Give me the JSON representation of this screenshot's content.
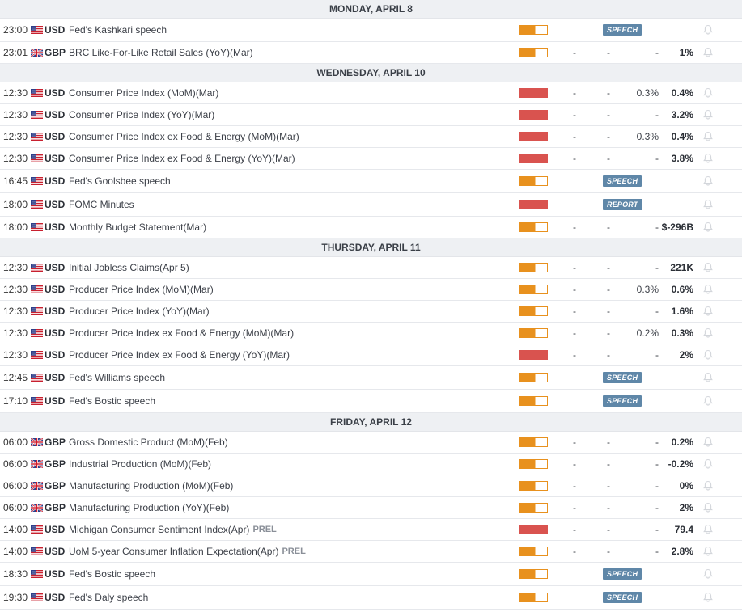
{
  "legend_colors": {
    "high_impact": "#d9534f",
    "medium_impact": "#e8911e",
    "badge": "#5f87a8"
  },
  "calendar": [
    {
      "day": "MONDAY, APRIL 8",
      "events": [
        {
          "time": "23:00",
          "flag_icon": "us-flag-icon",
          "currency": "USD",
          "name": "Fed's Kashkari speech",
          "impact": "medium",
          "badge": "SPEECH"
        },
        {
          "time": "23:01",
          "flag_icon": "uk-flag-icon",
          "currency": "GBP",
          "name": "BRC Like-For-Like Retail Sales (YoY)(Mar)",
          "impact": "medium",
          "actual": "-",
          "deviation": "-",
          "consensus": "-",
          "previous": "1%"
        }
      ]
    },
    {
      "day": "WEDNESDAY, APRIL 10",
      "events": [
        {
          "time": "12:30",
          "flag_icon": "us-flag-icon",
          "currency": "USD",
          "name": "Consumer Price Index (MoM)(Mar)",
          "impact": "high",
          "actual": "-",
          "deviation": "-",
          "consensus": "0.3%",
          "previous": "0.4%"
        },
        {
          "time": "12:30",
          "flag_icon": "us-flag-icon",
          "currency": "USD",
          "name": "Consumer Price Index (YoY)(Mar)",
          "impact": "high",
          "actual": "-",
          "deviation": "-",
          "consensus": "-",
          "previous": "3.2%"
        },
        {
          "time": "12:30",
          "flag_icon": "us-flag-icon",
          "currency": "USD",
          "name": "Consumer Price Index ex Food & Energy (MoM)(Mar)",
          "impact": "high",
          "actual": "-",
          "deviation": "-",
          "consensus": "0.3%",
          "previous": "0.4%"
        },
        {
          "time": "12:30",
          "flag_icon": "us-flag-icon",
          "currency": "USD",
          "name": "Consumer Price Index ex Food & Energy (YoY)(Mar)",
          "impact": "high",
          "actual": "-",
          "deviation": "-",
          "consensus": "-",
          "previous": "3.8%"
        },
        {
          "time": "16:45",
          "flag_icon": "us-flag-icon",
          "currency": "USD",
          "name": "Fed's Goolsbee speech",
          "impact": "medium",
          "badge": "SPEECH"
        },
        {
          "time": "18:00",
          "flag_icon": "us-flag-icon",
          "currency": "USD",
          "name": "FOMC Minutes",
          "impact": "high",
          "badge": "REPORT"
        },
        {
          "time": "18:00",
          "flag_icon": "us-flag-icon",
          "currency": "USD",
          "name": "Monthly Budget Statement(Mar)",
          "impact": "medium",
          "actual": "-",
          "deviation": "-",
          "consensus": "-",
          "previous": "$-296B"
        }
      ]
    },
    {
      "day": "THURSDAY, APRIL 11",
      "events": [
        {
          "time": "12:30",
          "flag_icon": "us-flag-icon",
          "currency": "USD",
          "name": "Initial Jobless Claims(Apr 5)",
          "impact": "medium",
          "actual": "-",
          "deviation": "-",
          "consensus": "-",
          "previous": "221K"
        },
        {
          "time": "12:30",
          "flag_icon": "us-flag-icon",
          "currency": "USD",
          "name": "Producer Price Index (MoM)(Mar)",
          "impact": "medium",
          "actual": "-",
          "deviation": "-",
          "consensus": "0.3%",
          "previous": "0.6%"
        },
        {
          "time": "12:30",
          "flag_icon": "us-flag-icon",
          "currency": "USD",
          "name": "Producer Price Index (YoY)(Mar)",
          "impact": "medium",
          "actual": "-",
          "deviation": "-",
          "consensus": "-",
          "previous": "1.6%"
        },
        {
          "time": "12:30",
          "flag_icon": "us-flag-icon",
          "currency": "USD",
          "name": "Producer Price Index ex Food & Energy (MoM)(Mar)",
          "impact": "medium",
          "actual": "-",
          "deviation": "-",
          "consensus": "0.2%",
          "previous": "0.3%"
        },
        {
          "time": "12:30",
          "flag_icon": "us-flag-icon",
          "currency": "USD",
          "name": "Producer Price Index ex Food & Energy (YoY)(Mar)",
          "impact": "high",
          "actual": "-",
          "deviation": "-",
          "consensus": "-",
          "previous": "2%"
        },
        {
          "time": "12:45",
          "flag_icon": "us-flag-icon",
          "currency": "USD",
          "name": "Fed's Williams speech",
          "impact": "medium",
          "badge": "SPEECH"
        },
        {
          "time": "17:10",
          "flag_icon": "us-flag-icon",
          "currency": "USD",
          "name": "Fed's Bostic speech",
          "impact": "medium",
          "badge": "SPEECH"
        }
      ]
    },
    {
      "day": "FRIDAY, APRIL 12",
      "events": [
        {
          "time": "06:00",
          "flag_icon": "uk-flag-icon",
          "currency": "GBP",
          "name": "Gross Domestic Product (MoM)(Feb)",
          "impact": "medium",
          "actual": "-",
          "deviation": "-",
          "consensus": "-",
          "previous": "0.2%"
        },
        {
          "time": "06:00",
          "flag_icon": "uk-flag-icon",
          "currency": "GBP",
          "name": "Industrial Production (MoM)(Feb)",
          "impact": "medium",
          "actual": "-",
          "deviation": "-",
          "consensus": "-",
          "previous": "-0.2%"
        },
        {
          "time": "06:00",
          "flag_icon": "uk-flag-icon",
          "currency": "GBP",
          "name": "Manufacturing Production (MoM)(Feb)",
          "impact": "medium",
          "actual": "-",
          "deviation": "-",
          "consensus": "-",
          "previous": "0%"
        },
        {
          "time": "06:00",
          "flag_icon": "uk-flag-icon",
          "currency": "GBP",
          "name": "Manufacturing Production (YoY)(Feb)",
          "impact": "medium",
          "actual": "-",
          "deviation": "-",
          "consensus": "-",
          "previous": "2%"
        },
        {
          "time": "14:00",
          "flag_icon": "us-flag-icon",
          "currency": "USD",
          "name": "Michigan Consumer Sentiment Index(Apr)",
          "tag": "PREL",
          "impact": "high",
          "actual": "-",
          "deviation": "-",
          "consensus": "-",
          "previous": "79.4"
        },
        {
          "time": "14:00",
          "flag_icon": "us-flag-icon",
          "currency": "USD",
          "name": "UoM 5-year Consumer Inflation Expectation(Apr)",
          "tag": "PREL",
          "impact": "medium",
          "actual": "-",
          "deviation": "-",
          "consensus": "-",
          "previous": "2.8%"
        },
        {
          "time": "18:30",
          "flag_icon": "us-flag-icon",
          "currency": "USD",
          "name": "Fed's Bostic speech",
          "impact": "medium",
          "badge": "SPEECH"
        },
        {
          "time": "19:30",
          "flag_icon": "us-flag-icon",
          "currency": "USD",
          "name": "Fed's Daly speech",
          "impact": "medium",
          "badge": "SPEECH"
        }
      ]
    }
  ]
}
